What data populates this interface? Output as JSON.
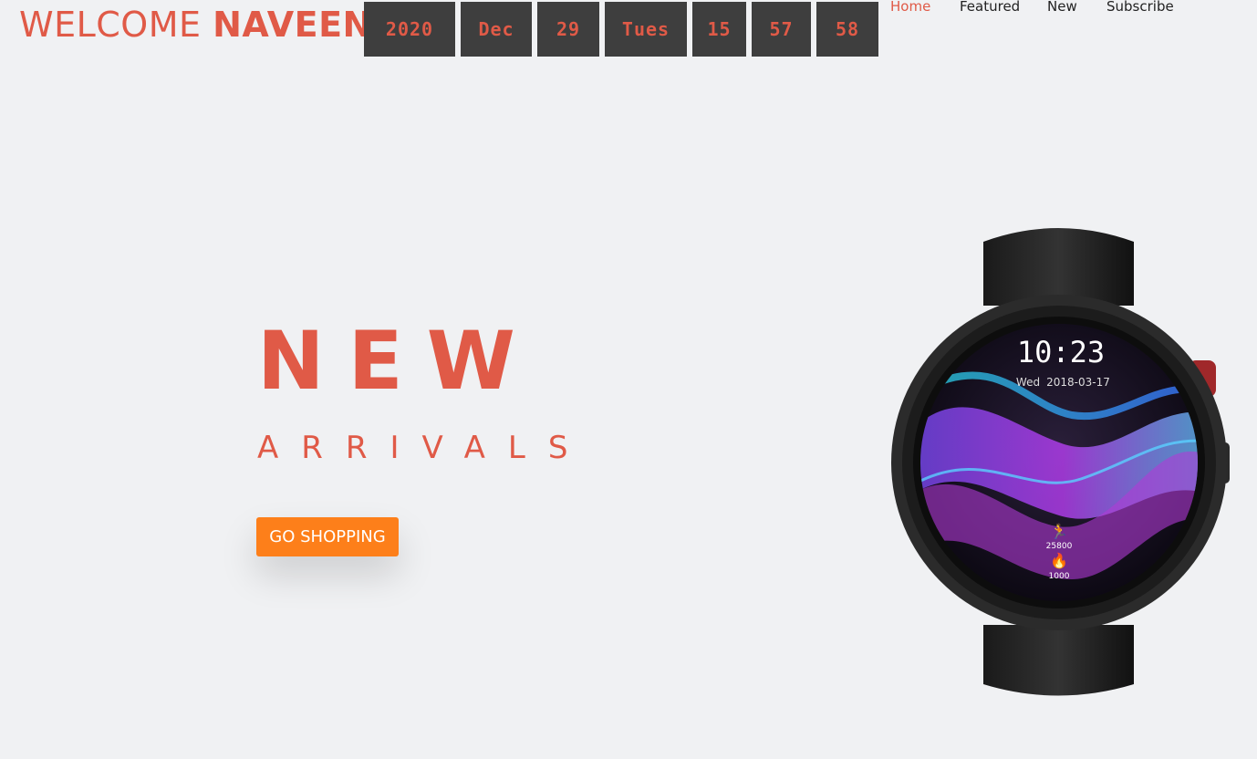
{
  "header": {
    "welcome": "WELCOME",
    "name": "NAVEEN"
  },
  "clock": {
    "year": "2020",
    "month": "Dec",
    "day": "29",
    "weekday": "Tues",
    "hour": "15",
    "minute": "57",
    "second": "58"
  },
  "nav": {
    "items": [
      {
        "label": "Home",
        "active": true
      },
      {
        "label": "Featured",
        "active": false
      },
      {
        "label": "New",
        "active": false
      },
      {
        "label": "Subscribe",
        "active": false
      }
    ]
  },
  "hero": {
    "title": "NEW",
    "subtitle": "ARRIVALS",
    "cta_label": "GO SHOPPING"
  },
  "watch": {
    "time": "10:23",
    "date_day": "Wed",
    "date": "2018-03-17",
    "steps": "25800",
    "calories": "1000"
  },
  "colors": {
    "accent": "#e05a47",
    "button": "#fd7f1a",
    "clock_bg": "#3e3e3e",
    "page_bg": "#f0f1f3"
  }
}
